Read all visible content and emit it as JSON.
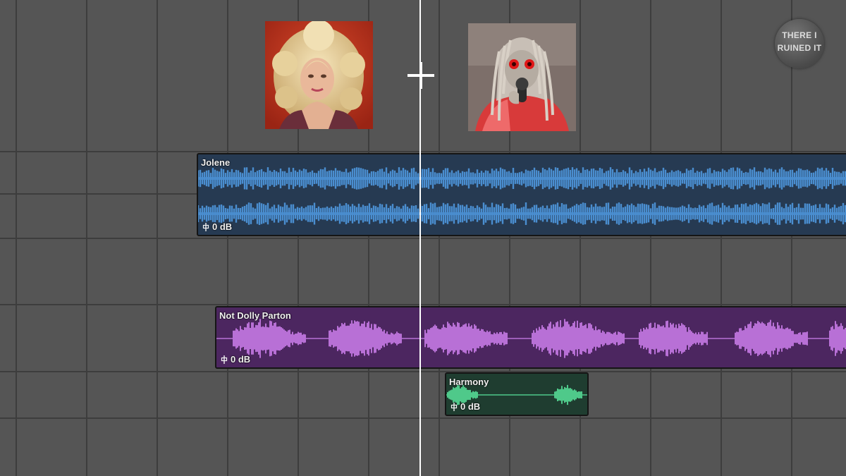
{
  "window": {
    "app": "DAW arrange view"
  },
  "images": [
    {
      "name": "photo-blonde-singer",
      "description": "portrait photo"
    },
    {
      "name": "photo-masked-performer",
      "description": "portrait photo"
    }
  ],
  "regions": [
    {
      "name": "Jolene",
      "gain": "0 dB",
      "color": "#4a8ed0",
      "body_color": "#263a52",
      "channels": 2
    },
    {
      "name": "Not Dolly Parton",
      "gain": "0 dB",
      "color": "#b870d6",
      "body_color": "#4c2660",
      "channels": 1
    },
    {
      "name": "Harmony",
      "gain": "0 dB",
      "color": "#4fc98a",
      "body_color": "#1f3d30",
      "channels": 1
    }
  ],
  "watermark": {
    "line1": "THERE I",
    "line2": "RUINED IT"
  },
  "icons": {
    "cursor": "crosshair-plus-icon",
    "gain": "fader-icon"
  },
  "colors": {
    "background": "#555555",
    "grid": "#3d3d3d",
    "playhead": "#ffffff"
  }
}
